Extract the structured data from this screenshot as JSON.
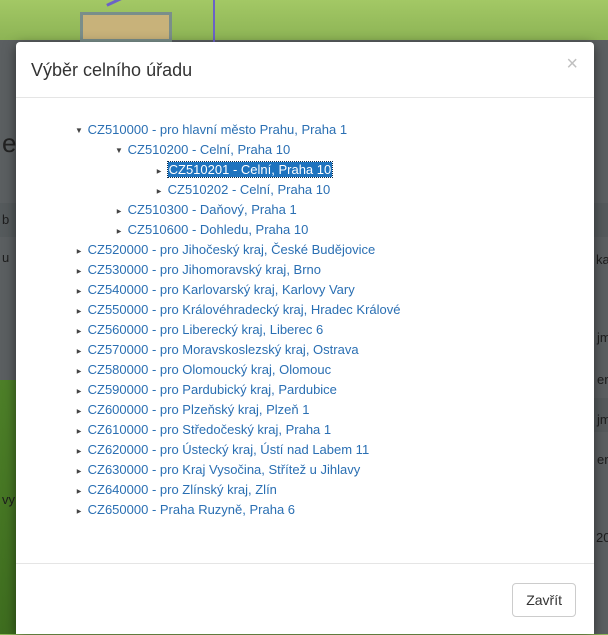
{
  "dialog": {
    "title": "Výběr celního úřadu",
    "close_symbol": "×",
    "close_button_label": "Zavřít"
  },
  "tree": {
    "items": [
      {
        "label": "CZ510000 - pro hlavní město Prahu, Praha 1",
        "level": 1,
        "expanded": true
      },
      {
        "label": "CZ510200 - Celní, Praha 10",
        "level": 2,
        "expanded": true
      },
      {
        "label": "CZ510201 - Celní, Praha 10",
        "level": 3,
        "expanded": false,
        "selected": true
      },
      {
        "label": "CZ510202 - Celní, Praha 10",
        "level": 3,
        "expanded": false
      },
      {
        "label": "CZ510300 - Daňový, Praha 1",
        "level": 2,
        "expanded": false
      },
      {
        "label": "CZ510600 - Dohledu, Praha 10",
        "level": 2,
        "expanded": false
      },
      {
        "label": "CZ520000 - pro Jihočeský kraj, České Budějovice",
        "level": 1,
        "expanded": false
      },
      {
        "label": "CZ530000 - pro Jihomoravský kraj, Brno",
        "level": 1,
        "expanded": false
      },
      {
        "label": "CZ540000 - pro Karlovarský kraj, Karlovy Vary",
        "level": 1,
        "expanded": false
      },
      {
        "label": "CZ550000 - pro Královéhradecký kraj, Hradec Králové",
        "level": 1,
        "expanded": false
      },
      {
        "label": "CZ560000 - pro Liberecký kraj, Liberec 6",
        "level": 1,
        "expanded": false
      },
      {
        "label": "CZ570000 - pro Moravskoslezský kraj, Ostrava",
        "level": 1,
        "expanded": false
      },
      {
        "label": "CZ580000 - pro Olomoucký kraj, Olomouc",
        "level": 1,
        "expanded": false
      },
      {
        "label": "CZ590000 - pro Pardubický kraj, Pardubice",
        "level": 1,
        "expanded": false
      },
      {
        "label": "CZ600000 - pro Plzeňský kraj, Plzeň 1",
        "level": 1,
        "expanded": false
      },
      {
        "label": "CZ610000 - pro Středočeský kraj, Praha 1",
        "level": 1,
        "expanded": false
      },
      {
        "label": "CZ620000 - pro Ústecký kraj, Ústí nad Labem 11",
        "level": 1,
        "expanded": false
      },
      {
        "label": "CZ630000 - pro Kraj Vysočina, Střítež u Jihlavy",
        "level": 1,
        "expanded": false
      },
      {
        "label": "CZ640000 - pro Zlínský kraj, Zlín",
        "level": 1,
        "expanded": false
      },
      {
        "label": "CZ650000 - Praha Ruzyně, Praha 6",
        "level": 1,
        "expanded": false
      }
    ]
  },
  "icons": {
    "expanded": "▼",
    "collapsed": "▶"
  },
  "background": {
    "fragments": [
      "e",
      "b",
      "u",
      "ka",
      "jm",
      "er",
      "jm",
      "er",
      "vy",
      "20"
    ]
  },
  "colors": {
    "link": "#2a6fb3",
    "selected_bg": "#1e73be",
    "overlay_top": "#8fb85a"
  }
}
